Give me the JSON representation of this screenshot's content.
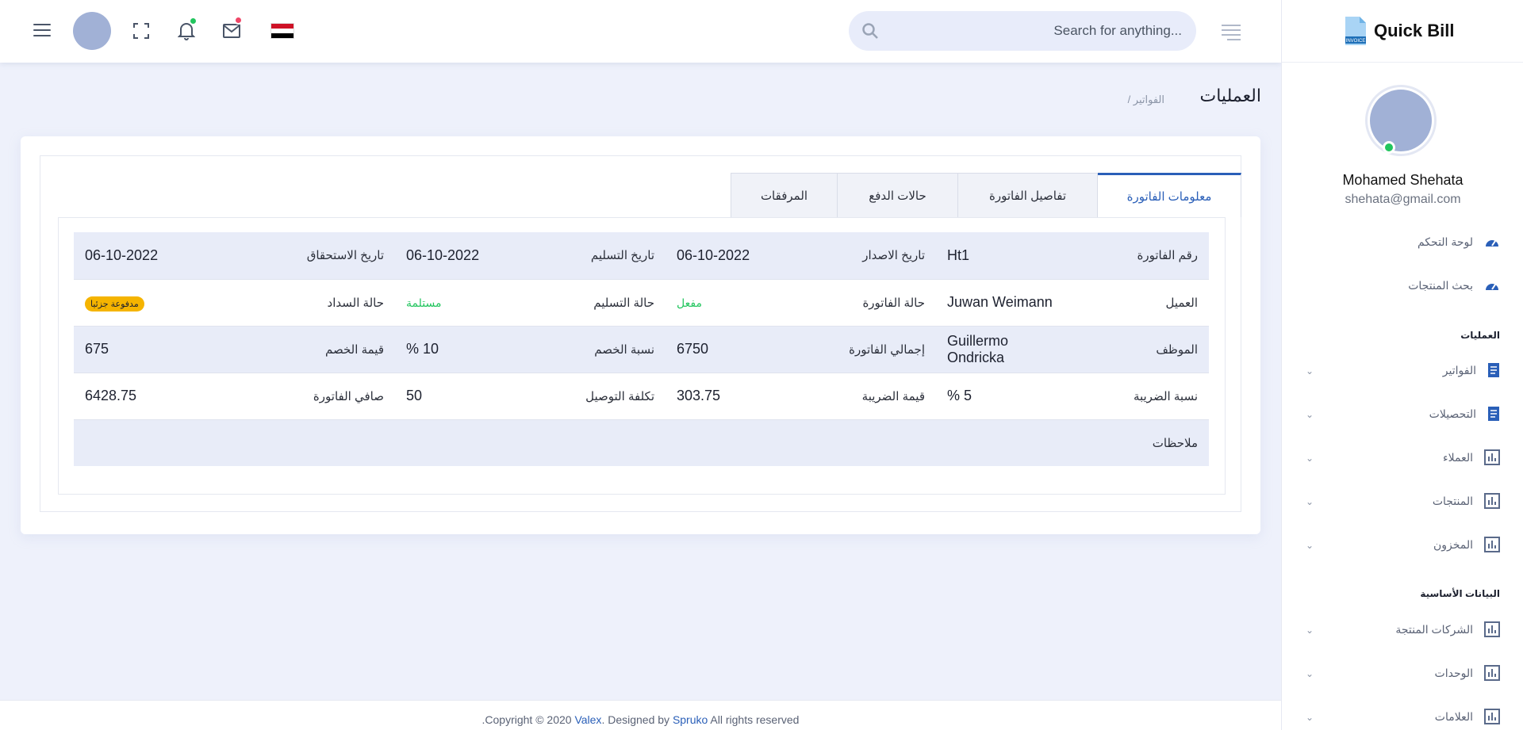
{
  "header": {
    "search_placeholder": "...Search for anything",
    "colors": {
      "notify_dot": "#22c55e",
      "mail_dot": "#ef4667",
      "accent": "#2a5fb8"
    }
  },
  "brand": {
    "name": "Quick Bill",
    "logo_caption": "INVOICE"
  },
  "profile": {
    "name": "Mohamed Shehata",
    "email": "shehata@gmail.com"
  },
  "sidebar": {
    "top_items": [
      {
        "label": "لوحة التحكم",
        "icon": "speedometer-icon"
      },
      {
        "label": "بحث المنتجات",
        "icon": "speedometer-icon"
      }
    ],
    "section_ops": "العمليات",
    "ops_items": [
      {
        "label": "الفواتير",
        "icon": "receipt-icon"
      },
      {
        "label": "التحصيلات",
        "icon": "receipt-icon"
      },
      {
        "label": "العملاء",
        "icon": "chart-icon"
      },
      {
        "label": "المنتجات",
        "icon": "chart-icon"
      },
      {
        "label": "المخزون",
        "icon": "chart-icon"
      }
    ],
    "section_basic": "البيانات الأساسية",
    "basic_items": [
      {
        "label": "الشركات المنتجة",
        "icon": "chart-icon"
      },
      {
        "label": "الوحدات",
        "icon": "chart-icon"
      },
      {
        "label": "العلامات",
        "icon": "chart-icon"
      }
    ]
  },
  "breadcrumb": {
    "title": "العمليات",
    "crumb": "/ الفواتير"
  },
  "tabs": [
    "معلومات الفاتورة",
    "تفاصيل الفاتورة",
    "حالات الدفع",
    "المرفقات"
  ],
  "invoice": {
    "row1": [
      "رقم الفاتورة",
      "Ht1",
      "تاريخ الاصدار",
      "06-10-2022",
      "تاريخ التسليم",
      "06-10-2022",
      "تاريخ الاستحقاق",
      "06-10-2022"
    ],
    "row2": [
      "العميل",
      "Juwan Weimann",
      "حالة الفاتورة",
      "مفعل",
      "حالة التسليم",
      "مستلمة",
      "حالة السداد",
      "مدفوعة جزئيا"
    ],
    "row3": [
      "الموظف",
      "Guillermo Ondricka",
      "إجمالي الفاتورة",
      "6750",
      "نسبة الخصم",
      "10 %",
      "قيمة الخصم",
      "675"
    ],
    "row4": [
      "نسبة الضريبة",
      "5 %",
      "قيمة الضريبة",
      "303.75",
      "تكلفة التوصيل",
      "50",
      "صافي الفاتورة",
      "6428.75"
    ],
    "notes_label": "ملاحظات"
  },
  "footer": {
    "pre": ".Copyright © 2020 ",
    "brand": "Valex",
    "mid": ". Designed by ",
    "designer": "Spruko",
    "post": " All rights reserved"
  }
}
